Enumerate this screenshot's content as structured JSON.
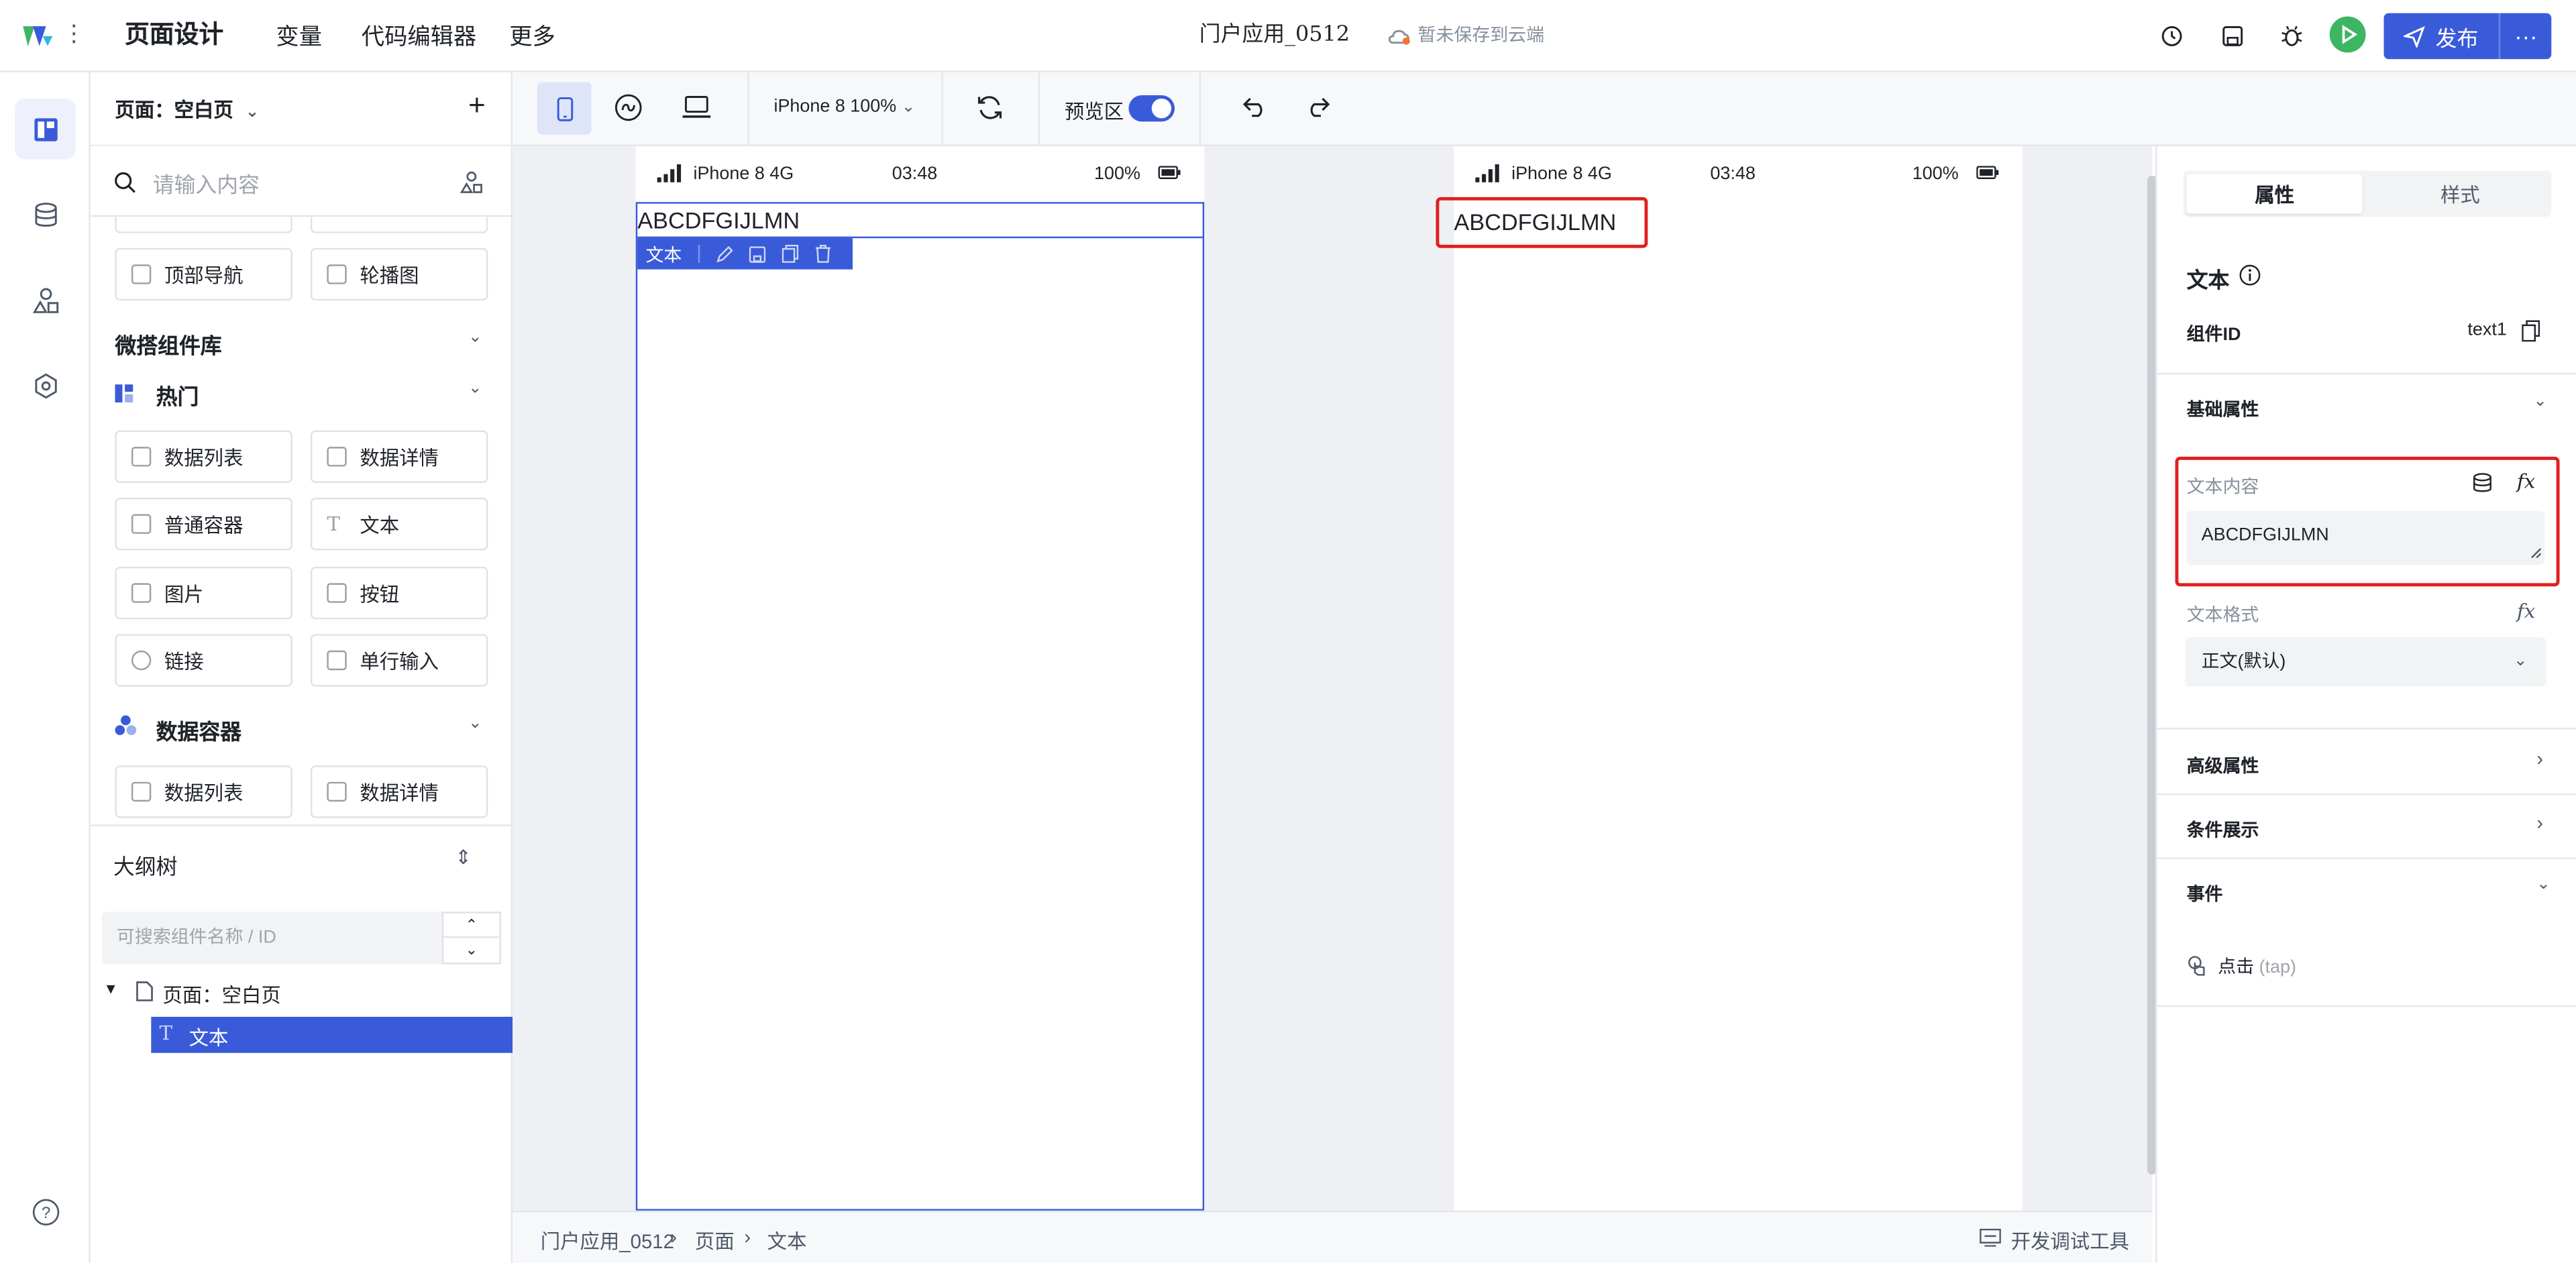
{
  "topbar": {
    "nav": [
      "页面设计",
      "变量",
      "代码编辑器",
      "更多"
    ],
    "app_title": "门户应用_0512",
    "save_status": "暂未保存到云端",
    "publish_label": "发布",
    "more_label": "···"
  },
  "left_panel": {
    "page_label": "页面：空白页",
    "search_placeholder": "请输入内容",
    "top_components": [
      "顶部导航",
      "轮播图"
    ],
    "library_title": "微搭组件库",
    "hot_title": "热门",
    "hot_components": [
      "数据列表",
      "数据详情",
      "普通容器",
      "文本",
      "图片",
      "按钮",
      "链接",
      "单行输入"
    ],
    "data_container_title": "数据容器",
    "data_container_components": [
      "数据列表",
      "数据详情"
    ],
    "outline_title": "大纲树",
    "outline_search_placeholder": "可搜索组件名称 / ID",
    "tree": [
      "页面：空白页",
      "文本"
    ]
  },
  "toolbar": {
    "device_label": "iPhone 8 100%",
    "preview_label": "预览区"
  },
  "canvas": {
    "status_left": "iPhone 8  4G",
    "status_time": "03:48",
    "status_battery": "100%",
    "text_content": "ABCDFGIJLMN",
    "selection_bar_label": "文本"
  },
  "bottombar": {
    "breadcrumb": [
      "门户应用_0512",
      "页面",
      "文本"
    ],
    "devtools_label": "开发调试工具"
  },
  "right_panel": {
    "tabs": [
      "属性",
      "样式"
    ],
    "component_title": "文本",
    "component_id_label": "组件ID",
    "component_id_value": "text1",
    "basic_props": "基础属性",
    "text_content_label": "文本内容",
    "text_content_value": "ABCDFGIJLMN",
    "text_format_label": "文本格式",
    "text_format_value": "正文(默认)",
    "advanced_props": "高级属性",
    "conditional": "条件展示",
    "events": "事件",
    "event_click": "点击",
    "event_click_tag": "(tap)",
    "fx_label": "fx"
  },
  "colors": {
    "accent": "#3a5bd9",
    "run_green": "#3db562",
    "highlight_red": "#e02020"
  }
}
